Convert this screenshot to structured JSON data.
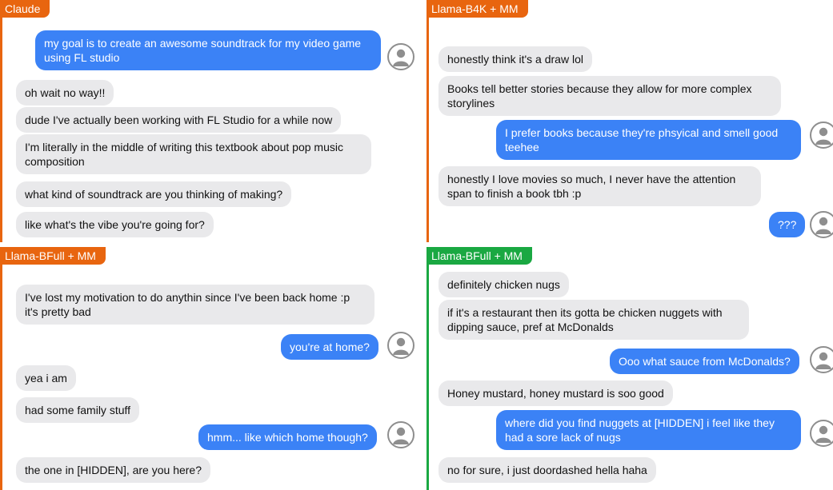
{
  "colors": {
    "orange": "#e8650f",
    "green": "#1aa842",
    "bubble_in": "#e9e9eb",
    "bubble_out": "#3b82f6"
  },
  "panels": [
    {
      "title": "Claude",
      "accent": "#e8650f",
      "messages": [
        {
          "side": "out",
          "text": "my goal is to create an awesome soundtrack for my video game using FL studio"
        },
        {
          "side": "in",
          "text": "oh wait no way!!"
        },
        {
          "side": "in",
          "text": "dude I've actually been working with FL Studio for a while now"
        },
        {
          "side": "in",
          "text": "I'm literally in the middle of writing this textbook about pop music composition"
        },
        {
          "side": "in",
          "text": "what kind of soundtrack are you thinking of making?"
        },
        {
          "side": "in",
          "text": "like what's the vibe you're going for?"
        }
      ]
    },
    {
      "title": "Llama-B4K + MM",
      "accent": "#e8650f",
      "messages": [
        {
          "side": "in",
          "text": "honestly think it's a draw lol"
        },
        {
          "side": "in",
          "text": "Books tell better stories because they allow for more complex storylines"
        },
        {
          "side": "out",
          "text": "I prefer books because they're phsyical and smell good teehee"
        },
        {
          "side": "in",
          "text": "honestly I love movies so much, I never have the attention span to finish a book tbh :p"
        },
        {
          "side": "out",
          "text": "???"
        }
      ]
    },
    {
      "title": "Llama-BFull + MM",
      "accent": "#e8650f",
      "messages": [
        {
          "side": "in",
          "text": "I've lost my motivation to do anythin since I've been back home :p it's pretty bad"
        },
        {
          "side": "out",
          "text": "you're at home?"
        },
        {
          "side": "in",
          "text": "yea i am"
        },
        {
          "side": "in",
          "text": "had some family stuff"
        },
        {
          "side": "out",
          "text": "hmm... like which home though?"
        },
        {
          "side": "in",
          "text": "the one in [HIDDEN], are you here?"
        }
      ]
    },
    {
      "title": "Llama-BFull + MM",
      "accent": "#1aa842",
      "messages": [
        {
          "side": "in",
          "text": "definitely chicken nugs"
        },
        {
          "side": "in",
          "text": "if it's a restaurant then its gotta be chicken nuggets with dipping sauce, pref at McDonalds"
        },
        {
          "side": "out",
          "text": "Ooo what sauce from McDonalds?"
        },
        {
          "side": "in",
          "text": "Honey mustard, honey mustard is soo good"
        },
        {
          "side": "out",
          "text": "where did you find nuggets at [HIDDEN] i feel like they had a sore lack of nugs"
        },
        {
          "side": "in",
          "text": "no for sure, i just doordashed hella haha"
        }
      ]
    }
  ]
}
